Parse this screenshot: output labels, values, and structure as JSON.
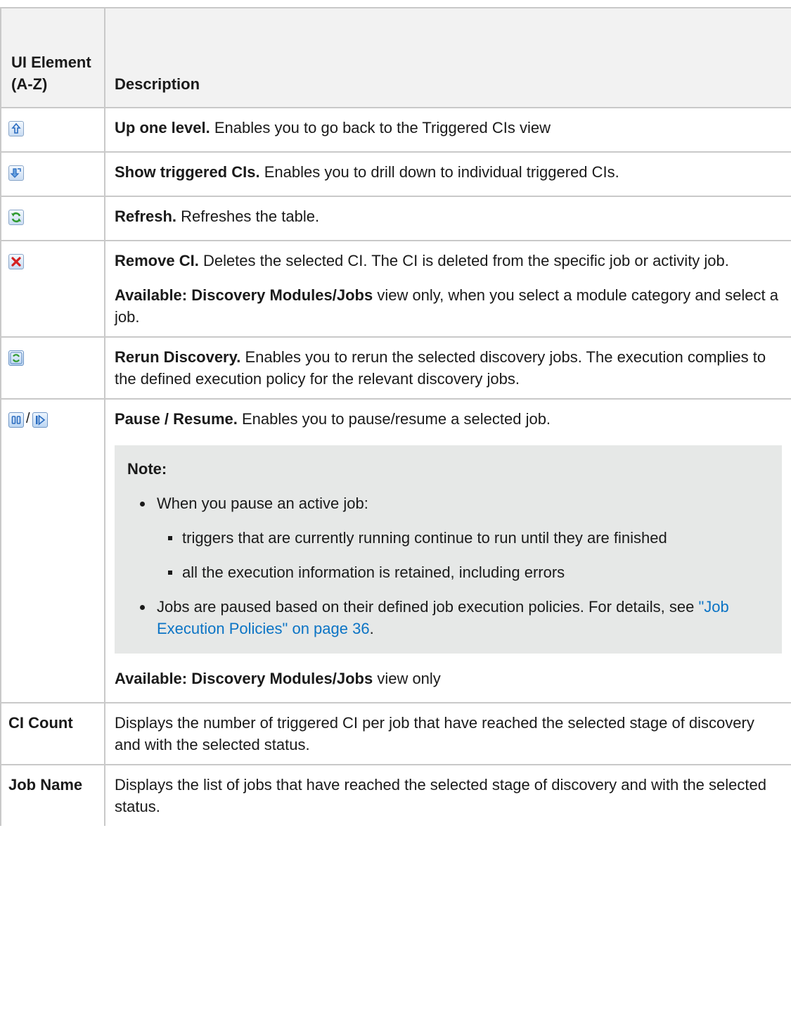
{
  "header": {
    "col1": "UI Element (A-Z)",
    "col2": "Description"
  },
  "rows": {
    "up": {
      "icon": "up-one-level-icon",
      "title": "Up one level.",
      "text": " Enables you to go back to the Triggered CIs view"
    },
    "show": {
      "icon": "show-triggered-cis-icon",
      "title": "Show triggered CIs.",
      "text": " Enables you to drill down to individual triggered CIs."
    },
    "refresh": {
      "icon": "refresh-icon",
      "title": "Refresh.",
      "text": " Refreshes the table."
    },
    "remove": {
      "icon": "remove-ci-icon",
      "title": "Remove CI.",
      "text": " Deletes the selected CI. The CI is deleted from the specific job or activity job.",
      "avail_label": "Available: Discovery Modules/Jobs",
      "avail_text": " view only, when you select a module category and select a job."
    },
    "rerun": {
      "icon": "rerun-discovery-icon",
      "title": "Rerun Discovery.",
      "text": " Enables you to rerun the selected discovery jobs. The execution complies to the defined execution policy for the relevant discovery jobs."
    },
    "pause": {
      "icons": [
        "pause-icon",
        "resume-icon"
      ],
      "separator": "/",
      "title": "Pause / Resume.",
      "text": " Enables you to pause/resume a selected job.",
      "note_title": "Note:",
      "bullet1": "When you pause an active job:",
      "sub1": "triggers that are currently running continue to run until they are finished",
      "sub2": "all the execution information is retained, including errors",
      "bullet2_text": "Jobs are paused based on their defined job execution policies. For details, see ",
      "bullet2_link": "\"Job Execution Policies\" on page 36",
      "bullet2_end": ".",
      "avail_label": "Available: Discovery Modules/Jobs",
      "avail_text": " view only"
    },
    "ci_count": {
      "name": "CI Count",
      "text": "Displays the number of triggered CI per job that have reached the selected stage of discovery and with the selected status."
    },
    "job_name": {
      "name": "Job Name",
      "text": "Displays the list of jobs that have reached the selected stage of discovery and with the selected status."
    }
  }
}
